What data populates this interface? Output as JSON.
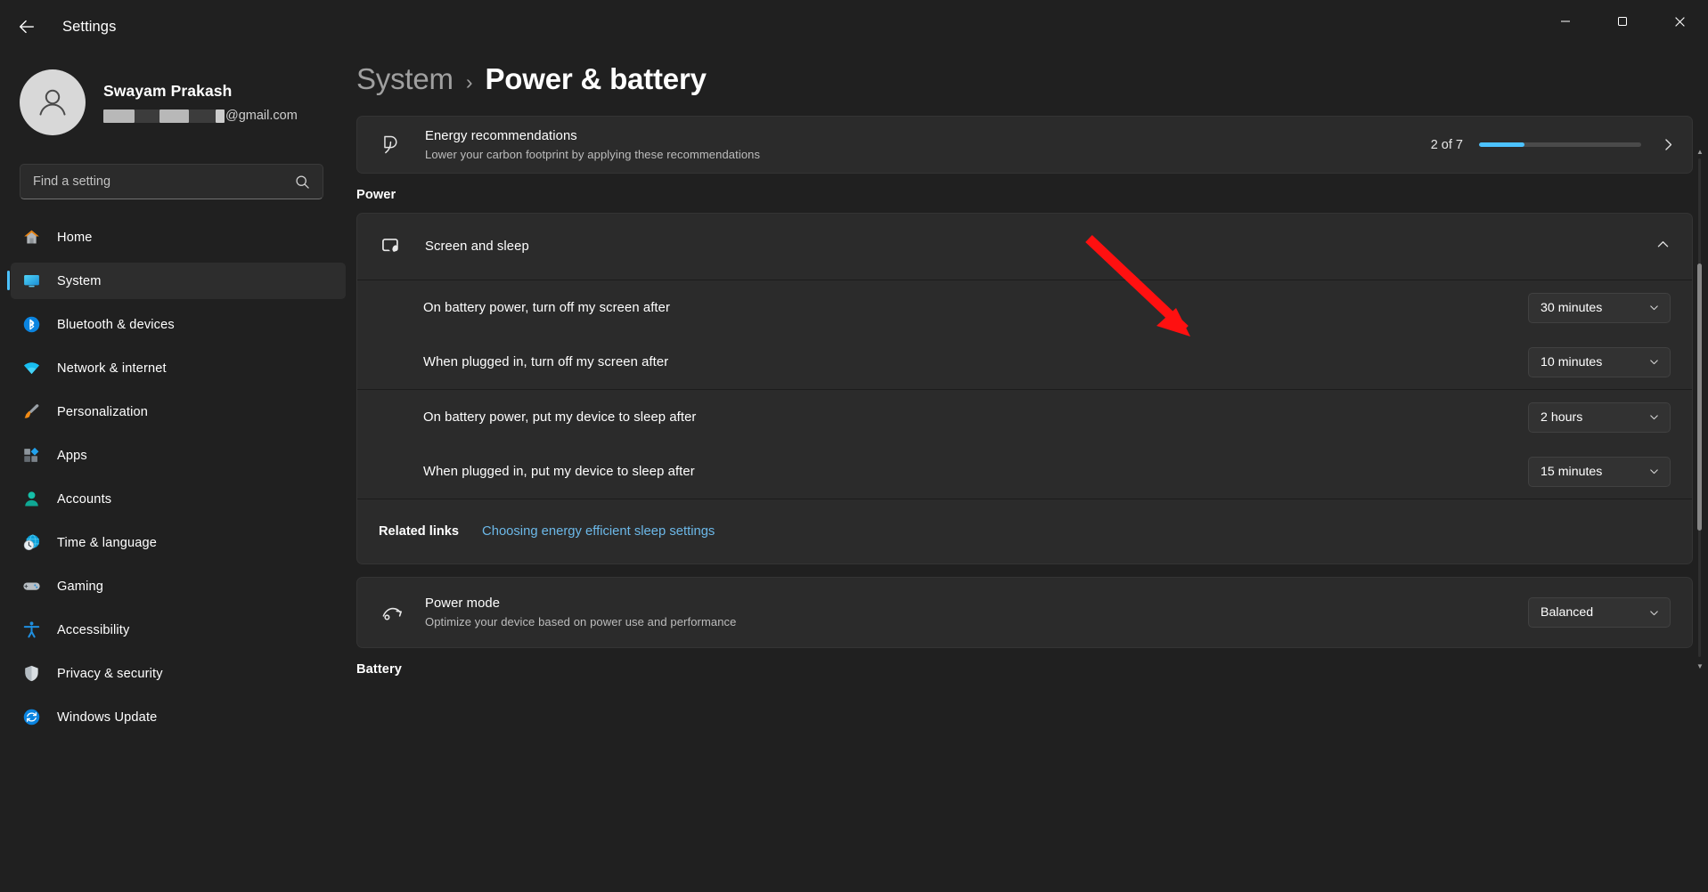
{
  "window": {
    "title": "Settings",
    "back_icon": "back-arrow-icon",
    "minimize_label": "Minimize",
    "maximize_label": "Maximize",
    "close_label": "Close"
  },
  "sidebar": {
    "profile": {
      "name": "Swayam Prakash",
      "email_domain": "@gmail.com",
      "avatar_icon": "user-avatar-icon"
    },
    "search": {
      "placeholder": "Find a setting",
      "value": "",
      "icon": "search-icon"
    },
    "items": [
      {
        "label": "Home",
        "icon": "home-icon",
        "active": false
      },
      {
        "label": "System",
        "icon": "system-icon",
        "active": true
      },
      {
        "label": "Bluetooth & devices",
        "icon": "bluetooth-icon",
        "active": false
      },
      {
        "label": "Network & internet",
        "icon": "wifi-icon",
        "active": false
      },
      {
        "label": "Personalization",
        "icon": "brush-icon",
        "active": false
      },
      {
        "label": "Apps",
        "icon": "apps-icon",
        "active": false
      },
      {
        "label": "Accounts",
        "icon": "accounts-icon",
        "active": false
      },
      {
        "label": "Time & language",
        "icon": "clock-globe-icon",
        "active": false
      },
      {
        "label": "Gaming",
        "icon": "gamepad-icon",
        "active": false
      },
      {
        "label": "Accessibility",
        "icon": "accessibility-icon",
        "active": false
      },
      {
        "label": "Privacy & security",
        "icon": "shield-icon",
        "active": false
      },
      {
        "label": "Windows Update",
        "icon": "update-icon",
        "active": false
      }
    ]
  },
  "main": {
    "breadcrumb": {
      "parent": "System",
      "separator": "›",
      "current": "Power & battery"
    },
    "energy_recommendations": {
      "title": "Energy recommendations",
      "subtitle": "Lower your carbon footprint by applying these recommendations",
      "count_text": "2 of 7",
      "progress_percent": 28,
      "icon": "energy-leaf-icon",
      "chevron_icon": "chevron-right-icon"
    },
    "power_section": {
      "heading": "Power"
    },
    "screen_and_sleep": {
      "title": "Screen and sleep",
      "icon": "screen-sleep-icon",
      "expand_icon": "chevron-up-icon",
      "rows": [
        {
          "label": "On battery power, turn off my screen after",
          "value": "30 minutes"
        },
        {
          "label": "When plugged in, turn off my screen after",
          "value": "10 minutes"
        },
        {
          "label": "On battery power, put my device to sleep after",
          "value": "2 hours"
        },
        {
          "label": "When plugged in, put my device to sleep after",
          "value": "15 minutes"
        }
      ],
      "related": {
        "label": "Related links",
        "link_text": "Choosing energy efficient sleep settings"
      }
    },
    "power_mode": {
      "title": "Power mode",
      "subtitle": "Optimize your device based on power use and performance",
      "value": "Balanced",
      "icon": "power-mode-icon"
    },
    "battery_section": {
      "heading": "Battery"
    }
  },
  "annotation": {
    "type": "red-arrow",
    "color": "#ff1010",
    "points_to": "On battery power, turn off my screen after dropdown"
  },
  "colors": {
    "accent": "#4cc2ff",
    "link": "#6cb8e8",
    "window_bg": "#202020",
    "card_bg": "#2b2b2b",
    "annotation_red": "#ff1010"
  }
}
